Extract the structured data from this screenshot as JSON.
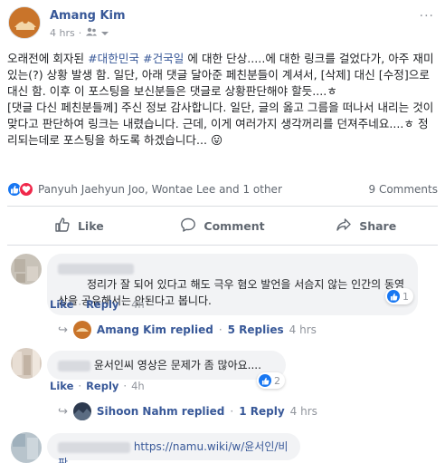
{
  "post": {
    "author": "Amang Kim",
    "time": "4 hrs",
    "more_label": "···",
    "paragraph1": [
      {
        "t": "오래전에 회자된 ",
        "tag": false
      },
      {
        "t": "#대한민국",
        "tag": true
      },
      {
        "t": " ",
        "tag": false
      },
      {
        "t": "#건국일",
        "tag": true
      },
      {
        "t": " 에 대한 단상.....에 대한 링크를 걸었다가, 아주 재미있는(?) 상황 발생 함. 일단, 아래 댓글 달아준 페친분들이 계셔서, [삭제] 대신 [수정]으로 대신 함. 이후 이 포스팅을 보신분들은 댓글로 상황판단해야 할듯....ㅎ",
        "tag": false
      }
    ],
    "paragraph2": "[댓글 다신 페친분들께] 주신 정보 감사합니다. 일단, 글의 옳고 그름을 떠나서 내리는 것이 맞다고 판단하여 링크는 내렸습니다. 근데, 이게 여러가지 생각꺼리를 던져주네요....ㅎ 정리되는데로 포스팅을 하도록 하겠습니다... 😛"
  },
  "summary": {
    "names": "Panyuh Jaehyun Joo, Wontae Lee and 1 other",
    "comments": "9 Comments"
  },
  "actions": {
    "like": "Like",
    "comment": "Comment",
    "share": "Share"
  },
  "comments": [
    {
      "text": "정리가 잘 되어 있다고 해도 극우 혐오 발언을 서슴지 않는 인간의 동영상을 공유해서는 안된다고 봅니다.",
      "like": "Like",
      "reply": "Reply",
      "time": "4h",
      "reactions": "1",
      "replied_by": "Amang Kim replied",
      "replies": "5 Replies",
      "reply_time": "4 hrs"
    },
    {
      "text": "윤서인씨 영상은 문제가 좀 많아요....",
      "like": "Like",
      "reply": "Reply",
      "time": "4h",
      "reactions": "2",
      "replied_by": "Sihoon Nahm replied",
      "replies": "1 Reply",
      "reply_time": "4 hrs"
    },
    {
      "text": "https://namu.wiki/w/윤서인/비판"
    }
  ],
  "colors": {
    "link": "#385898",
    "like_blue": "#1877f2",
    "love_red": "#f0284a"
  }
}
